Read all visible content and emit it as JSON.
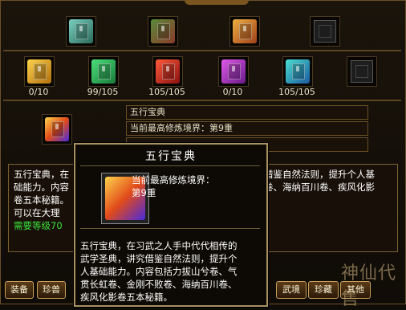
{
  "top_slots": [
    {
      "icon": "book-icon",
      "color": "#3a8a7a"
    },
    {
      "icon": "scroll-bundle-icon",
      "color": "#6a5a2a"
    },
    {
      "icon": "treasure-chest-icon",
      "color": "#c87a1a"
    },
    {
      "icon": "empty-slot-icon",
      "color": "#333333"
    }
  ],
  "books": [
    {
      "icon": "book-icon",
      "color": "#d8a01a",
      "count": "0/10"
    },
    {
      "icon": "book-icon",
      "color": "#2a9a4a",
      "count": "99/105"
    },
    {
      "icon": "book-icon",
      "color": "#c8201a",
      "count": "105/105"
    },
    {
      "icon": "book-icon",
      "color": "#a02ab0",
      "count": "0/10"
    },
    {
      "icon": "book-icon",
      "color": "#2a7aa8",
      "count": "105/105"
    },
    {
      "icon": "empty-slot-icon",
      "color": "#333333",
      "count": ""
    }
  ],
  "detail": {
    "name": "五行宝典",
    "realm": "当前最高修炼境界：第9重"
  },
  "description": {
    "line1_a": "五行宝典，在",
    "line1_b": "借鉴自然法则，提升个人基",
    "line2_a": "础能力。内容",
    "line2_b": "卷、海纳百川卷、疾风化影",
    "line3": "卷五本秘籍。",
    "line4": "可以在大理",
    "line5": "需要等级70"
  },
  "tooltip": {
    "title": "五行宝典",
    "realm_label": "当前最高修炼境界：",
    "realm_value": "第9重",
    "body": [
      "五行宝典，在习武之人手中代代相传的",
      "武学圣典，讲究借鉴自然法则，提升个",
      "人基础能力。内容包括力拔山兮卷、气",
      "贯长虹卷、金刚不败卷、海纳百川卷、",
      "疾风化影卷五本秘籍。"
    ]
  },
  "buttons": {
    "equip": "装备",
    "beast": "珍兽",
    "martial": "武境",
    "collection": "珍藏",
    "other": "其他"
  },
  "watermark": "神仙代售"
}
